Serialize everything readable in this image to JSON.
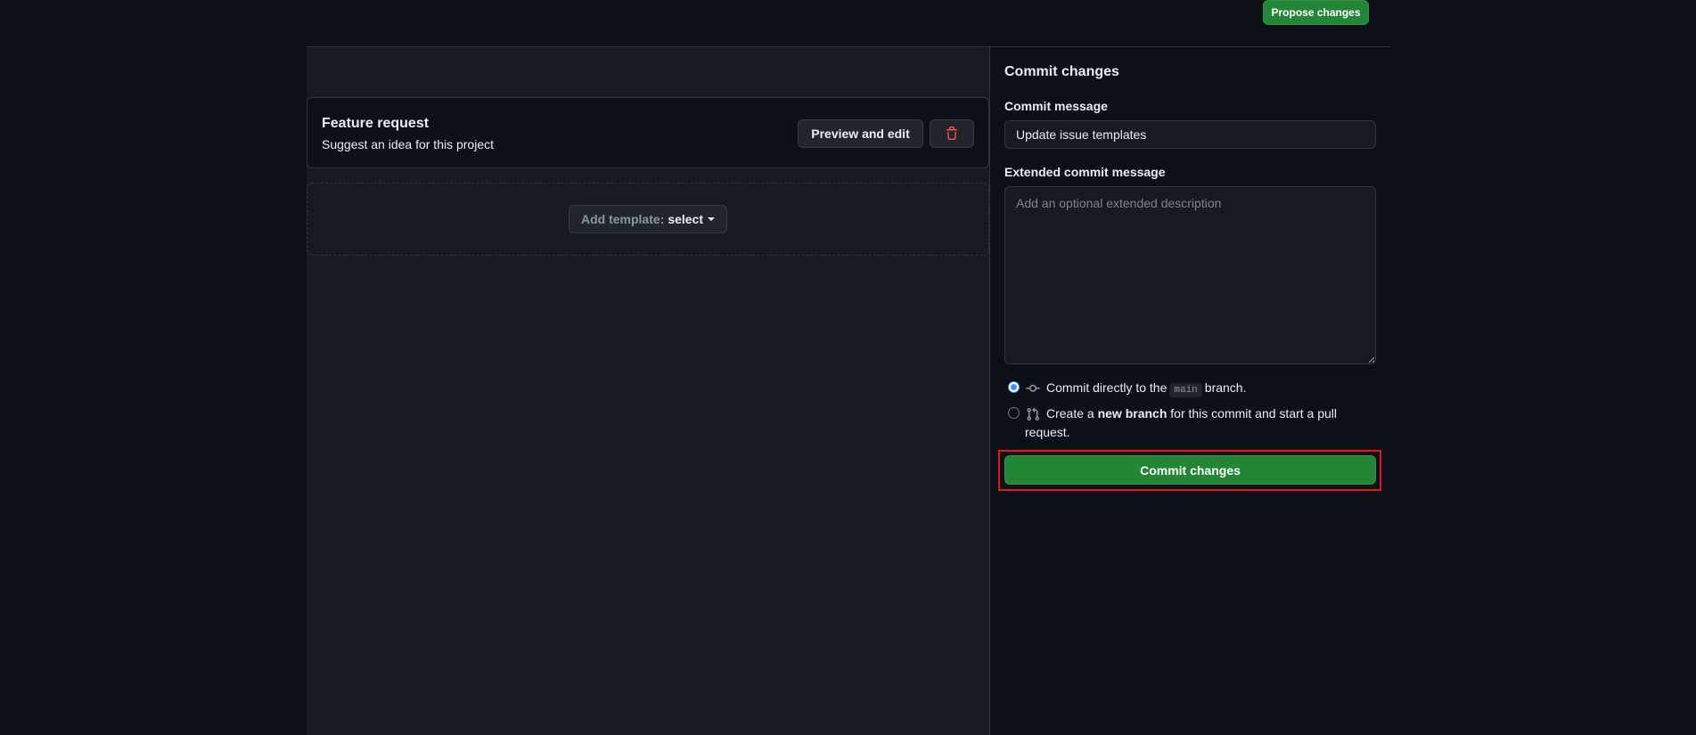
{
  "header": {
    "propose_label": "Propose changes"
  },
  "templates": {
    "items": [
      {
        "title": "Feature request",
        "description": "Suggest an idea for this project",
        "preview_label": "Preview and edit",
        "delete_icon": "trash-icon"
      }
    ],
    "add_template": {
      "label": "Add template:",
      "select_label": "select"
    }
  },
  "commit_panel": {
    "heading": "Commit changes",
    "message_label": "Commit message",
    "message_value": "Update issue templates",
    "extended_label": "Extended commit message",
    "extended_placeholder": "Add an optional extended description",
    "option_direct": {
      "prefix": "Commit directly to the",
      "branch": "main",
      "suffix": "branch.",
      "checked": true,
      "icon": "git-commit-icon"
    },
    "option_new_branch": {
      "prefix": "Create a",
      "bold": "new branch",
      "suffix_line1": "for this commit and start a pull",
      "suffix_line2": "request.",
      "checked": false,
      "icon": "git-pull-request-icon"
    },
    "commit_button_label": "Commit changes"
  },
  "colors": {
    "background": "#0d1117",
    "pane": "#161b22",
    "green_button": "#238636",
    "highlight": "#e5141b",
    "danger": "#f85149"
  }
}
